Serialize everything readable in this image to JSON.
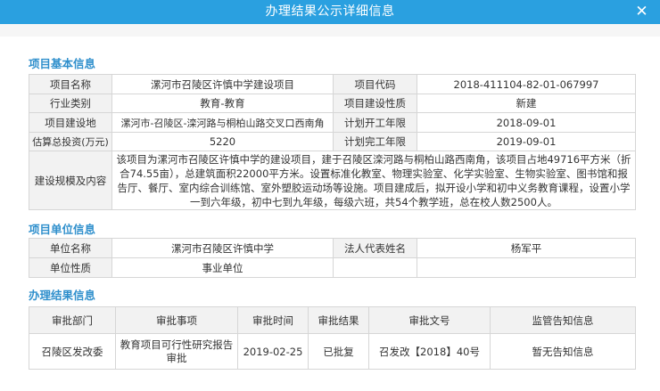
{
  "window": {
    "title": "办理结果公示详细信息",
    "close_glyph": "✕"
  },
  "sections": {
    "basic": "项目基本信息",
    "unit": "项目单位信息",
    "result": "办理结果信息"
  },
  "basic": {
    "name_label": "项目名称",
    "name_value": "漯河市召陵区许慎中学建设项目",
    "code_label": "项目代码",
    "code_value": "2018-411104-82-01-067997",
    "industry_label": "行业类别",
    "industry_value": "教育-教育",
    "nature_label": "项目建设性质",
    "nature_value": "新建",
    "site_label": "项目建设地",
    "site_value": "漯河市-召陵区-滦河路与桐柏山路交叉口西南角",
    "start_label": "计划开工年限",
    "start_value": "2018-09-01",
    "invest_label": "估算总投资(万元)",
    "invest_value": "5220",
    "finish_label": "计划完工年限",
    "finish_value": "2019-09-01",
    "scale_label": "建设规模及内容",
    "scale_value": "该项目为漯河市召陵区许慎中学的建设项目，建于召陵区滦河路与桐柏山路西南角，该项目占地49716平方米（折合74.55亩），总建筑面积22000平方米。设置标准化教室、物理实验室、化学实验室、生物实验室、图书馆和报告厅、餐厅、室内综合训练馆、室外塑胶运动场等设施。项目建成后，拟开设小学和初中义务教育课程，设置小学一到六年级，初中七到九年级，每级六班，共54个教学班，总在校人数2500人。"
  },
  "unit": {
    "name_label": "单位名称",
    "name_value": "漯河市召陵区许慎中学",
    "rep_label": "法人代表姓名",
    "rep_value": "杨军平",
    "type_label": "单位性质",
    "type_value": "事业单位"
  },
  "result": {
    "headers": [
      "审批部门",
      "审批事项",
      "审批时间",
      "审批结果",
      "审批文号",
      "监管告知信息"
    ],
    "rows": [
      [
        "召陵区发改委",
        "教育项目可行性研究报告审批",
        "2019-02-25",
        "已批复",
        "召发改【2018】40号",
        "暂无告知信息"
      ]
    ]
  }
}
